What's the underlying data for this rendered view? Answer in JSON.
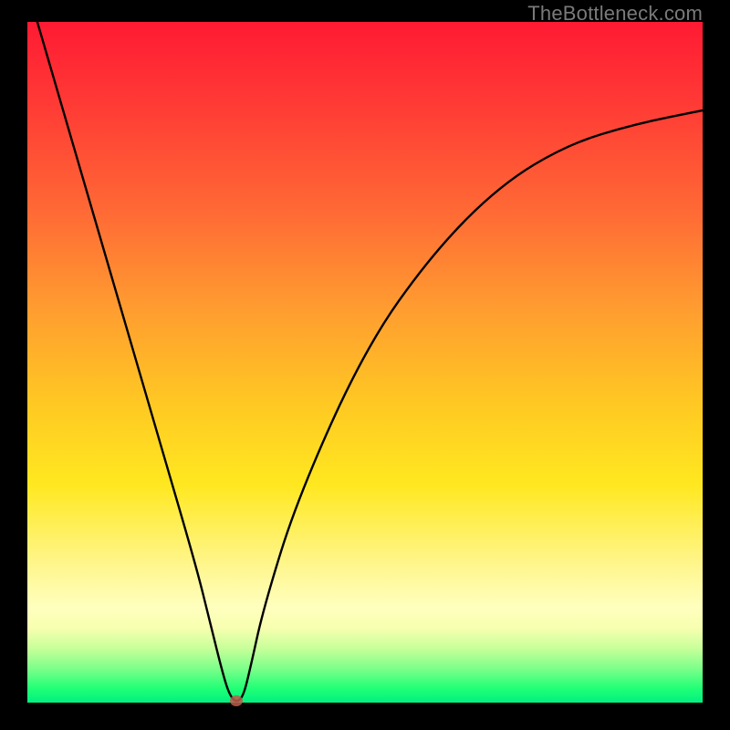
{
  "watermark": "TheBottleneck.com",
  "colors": {
    "frame": "#000000",
    "curve": "#000000",
    "marker": "#c05a4a",
    "gradient_top": "#ff1a33",
    "gradient_bottom": "#00f080"
  },
  "chart_data": {
    "type": "line",
    "title": "",
    "xlabel": "",
    "ylabel": "",
    "xlim": [
      0,
      100
    ],
    "ylim": [
      0,
      100
    ],
    "series": [
      {
        "name": "bottleneck-curve",
        "x": [
          0,
          5,
          10,
          15,
          20,
          25,
          27,
          29,
          30,
          31,
          32,
          33,
          35,
          40,
          50,
          60,
          70,
          80,
          90,
          100
        ],
        "values": [
          105,
          88,
          71,
          54,
          37,
          20,
          12,
          4,
          1,
          0,
          1,
          5,
          14,
          30,
          52,
          66,
          76,
          82,
          85,
          87
        ]
      }
    ],
    "marker": {
      "x": 31,
      "y": 0,
      "name": "optimal-point"
    },
    "grid": false,
    "legend": false
  }
}
